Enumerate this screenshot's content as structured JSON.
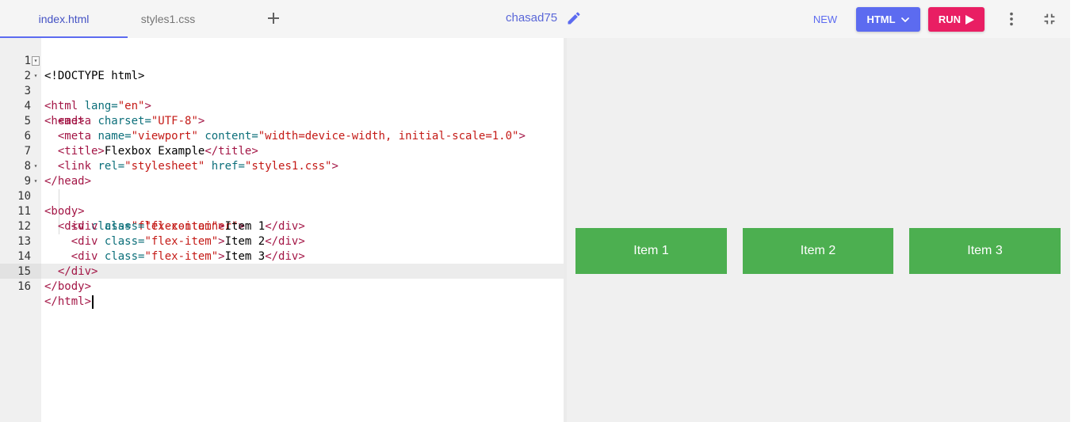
{
  "tabs": [
    {
      "label": "index.html",
      "active": true
    },
    {
      "label": "styles1.css",
      "active": false
    }
  ],
  "project_name": "chasad75",
  "toolbar": {
    "new_label": "NEW",
    "language_label": "HTML",
    "run_label": "RUN"
  },
  "icons": {
    "add_tab": "plus-icon",
    "edit": "pencil-icon",
    "language_dropdown": "chevron-down-icon",
    "run": "play-icon",
    "more": "vertical-dots-icon",
    "collapse": "collapse-icon"
  },
  "colors": {
    "accent": "#5c6bf0",
    "run": "#e91e63",
    "flex_item": "#4caf50"
  },
  "editor": {
    "active_line": 16,
    "lines": [
      {
        "n": "1"
      },
      {
        "n": "2"
      },
      {
        "n": "3"
      },
      {
        "n": "4"
      },
      {
        "n": "5"
      },
      {
        "n": "6"
      },
      {
        "n": "7"
      },
      {
        "n": "8"
      },
      {
        "n": "9"
      },
      {
        "n": "10"
      },
      {
        "n": "11"
      },
      {
        "n": "12"
      },
      {
        "n": "13"
      },
      {
        "n": "14"
      },
      {
        "n": "15"
      },
      {
        "n": "16"
      }
    ],
    "code": {
      "l1": "<!DOCTYPE html>",
      "l2_tag": "<html",
      "l2_attr": " lang=",
      "l2_str": "\"en\"",
      "l2_end": ">",
      "l3": "<head>",
      "l4_tag": "<meta",
      "l4_attr": " charset=",
      "l4_str": "\"UTF-8\"",
      "l4_end": ">",
      "l5_tag": "<meta",
      "l5_attr1": " name=",
      "l5_str1": "\"viewport\"",
      "l5_attr2": " content=",
      "l5_str2": "\"width=device-width, initial-scale=1.0\"",
      "l5_end": ">",
      "l6_open": "<title>",
      "l6_text": "Flexbox Example",
      "l6_close": "</title>",
      "l7_tag": "<link",
      "l7_attr1": " rel=",
      "l7_str1": "\"stylesheet\"",
      "l7_attr2": " href=",
      "l7_str2": "\"styles1.css\"",
      "l7_end": ">",
      "l8": "</head>",
      "l9": "<body>",
      "l10_tag": "<div",
      "l10_attr": " class=",
      "l10_str": "\"flex-container\"",
      "l10_end": ">",
      "l11_tag": "<div",
      "l11_attr": " class=",
      "l11_str": "\"flex-item\"",
      "l11_end": ">",
      "l11_text": "Item 1",
      "l11_close": "</div>",
      "l12_tag": "<div",
      "l12_attr": " class=",
      "l12_str": "\"flex-item\"",
      "l12_end": ">",
      "l12_text": "Item 2",
      "l12_close": "</div>",
      "l13_tag": "<div",
      "l13_attr": " class=",
      "l13_str": "\"flex-item\"",
      "l13_end": ">",
      "l13_text": "Item 3",
      "l13_close": "</div>",
      "l14": "</div>",
      "l15": "</body>",
      "l16": "</html>"
    }
  },
  "preview": {
    "items": [
      "Item 1",
      "Item 2",
      "Item 3"
    ]
  }
}
